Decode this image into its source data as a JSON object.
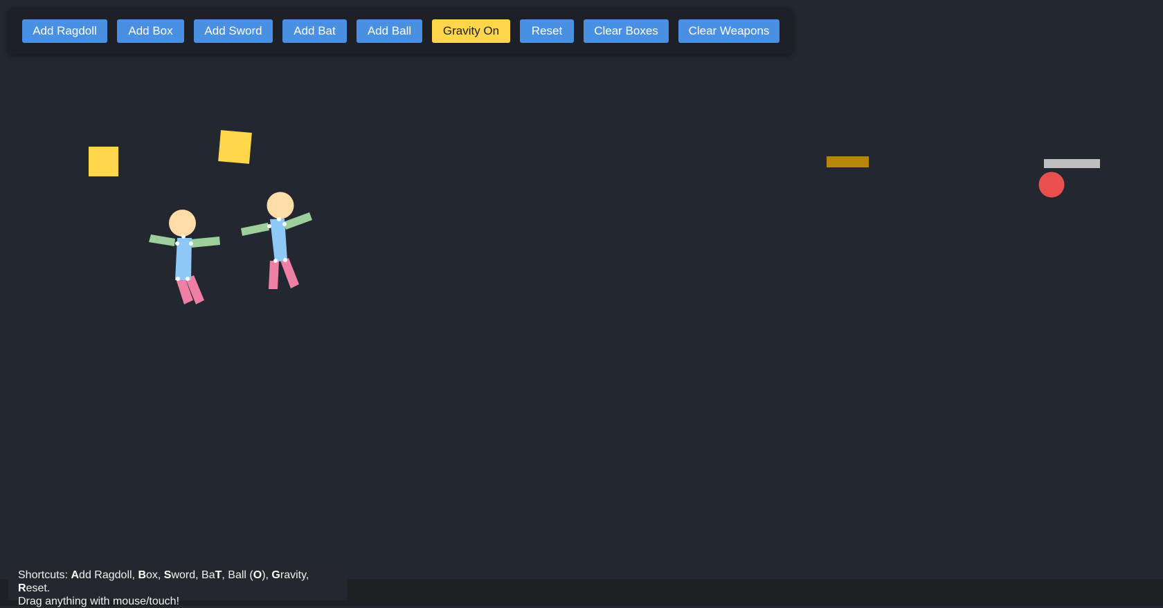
{
  "toolbar": {
    "buttons": [
      {
        "label": "Add Ragdoll"
      },
      {
        "label": "Add Box"
      },
      {
        "label": "Add Sword"
      },
      {
        "label": "Add Bat"
      },
      {
        "label": "Add Ball"
      },
      {
        "label": "Gravity On",
        "active": true
      },
      {
        "label": "Reset"
      },
      {
        "label": "Clear Boxes"
      },
      {
        "label": "Clear Weapons"
      }
    ]
  },
  "hint": {
    "shortcuts_prefix": "Shortcuts: ",
    "k_a": "A",
    "t_a": "dd Ragdoll, ",
    "k_b": "B",
    "t_b": "ox, ",
    "k_s": "S",
    "t_s": "word, Ba",
    "k_t": "T",
    "t_t": ", Ball (",
    "k_o": "O",
    "t_o": "), ",
    "k_g": "G",
    "t_g": "ravity, ",
    "k_r": "R",
    "t_r": "eset.",
    "line2": "Drag anything with mouse/touch!"
  },
  "colors": {
    "background": "#23272f",
    "button": "#4a90e2",
    "button_active": "#ffd54a",
    "box": "#ffd54a",
    "head": "#ffdca8",
    "torso": "#8ec8f6",
    "arms": "#9ccf9c",
    "legs": "#f07fa6",
    "bat": "#b8860b",
    "sword": "#c0c0c0",
    "ball": "#e94f4f"
  }
}
